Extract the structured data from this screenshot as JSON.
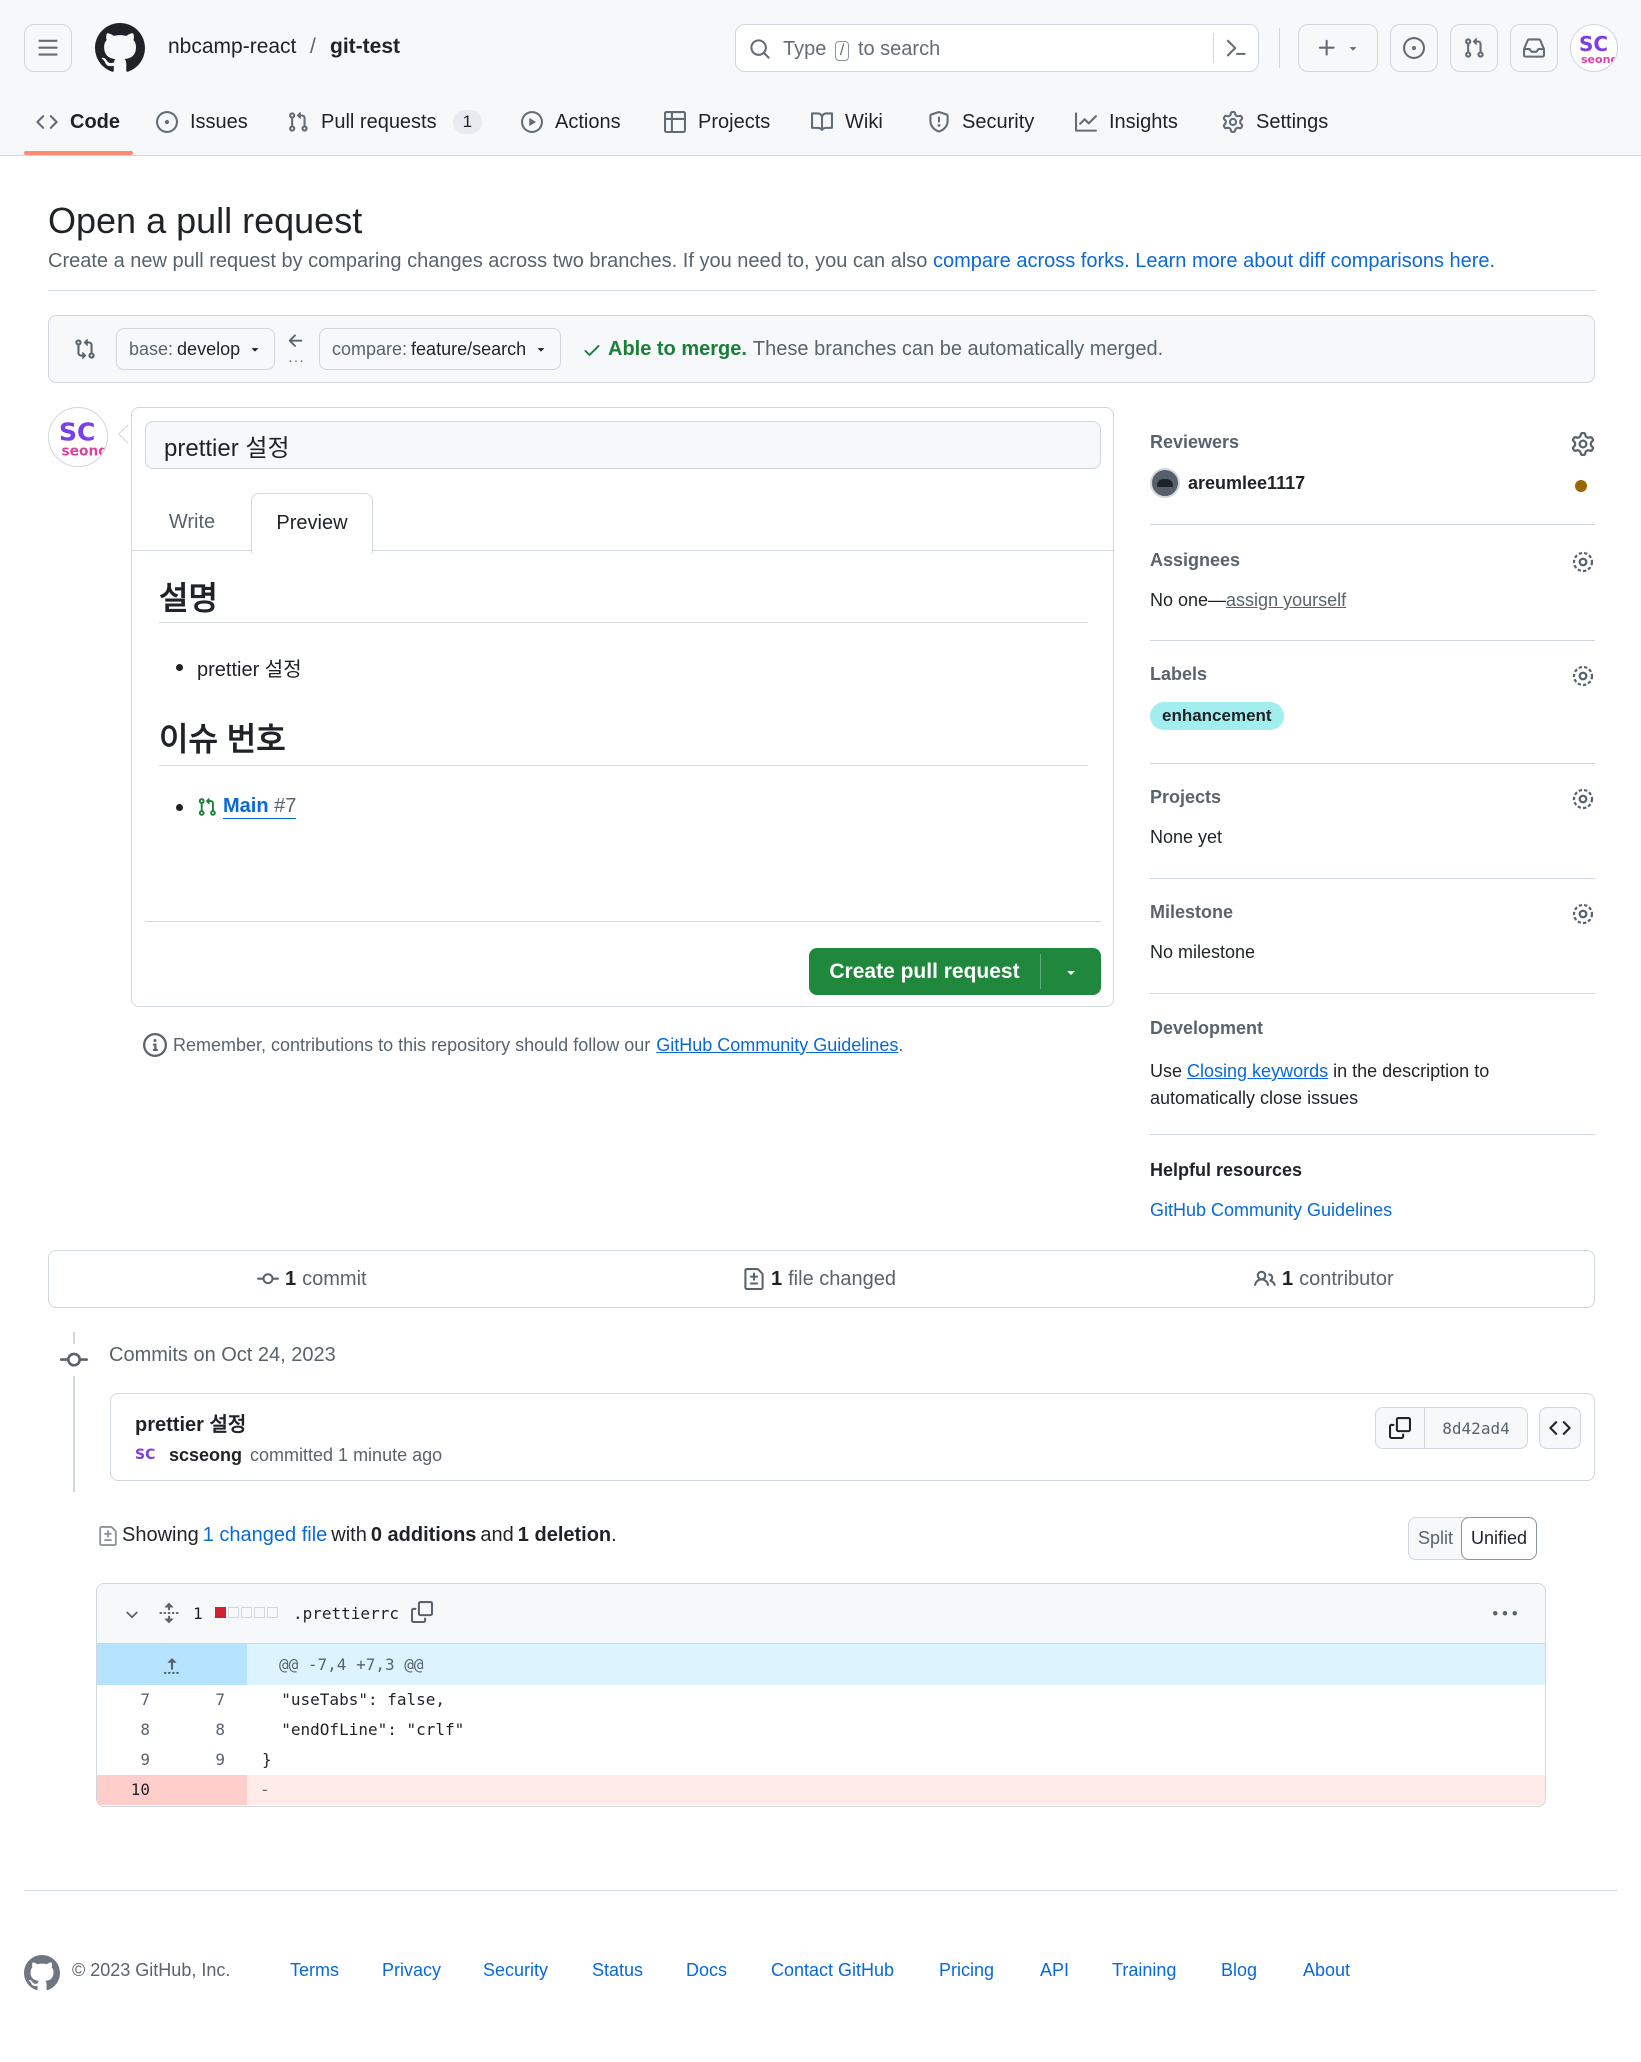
{
  "header": {
    "owner": "nbcamp-react",
    "separator": "/",
    "repo": "git-test",
    "search": {
      "before": "Type",
      "key": "/",
      "after": "to search"
    }
  },
  "repo_tabs": [
    {
      "label": "Code",
      "icon": "code-icon"
    },
    {
      "label": "Issues",
      "icon": "issue-opened-icon"
    },
    {
      "label": "Pull requests",
      "icon": "git-pull-request-icon",
      "count": "1"
    },
    {
      "label": "Actions",
      "icon": "play-icon"
    },
    {
      "label": "Projects",
      "icon": "table-icon"
    },
    {
      "label": "Wiki",
      "icon": "book-icon"
    },
    {
      "label": "Security",
      "icon": "shield-icon"
    },
    {
      "label": "Insights",
      "icon": "graph-icon"
    },
    {
      "label": "Settings",
      "icon": "gear-icon"
    }
  ],
  "page": {
    "title": "Open a pull request",
    "subtitle_text": "Create a new pull request by comparing changes across two branches. If you need to, you can also",
    "subtitle_link1": "compare across forks.",
    "subtitle_link2": "Learn more about diff comparisons here."
  },
  "compare": {
    "base_label": "base:",
    "base_value": "develop",
    "compare_label": "compare:",
    "compare_value": "feature/search",
    "merge_status": "Able to merge.",
    "merge_note": "These branches can be automatically merged."
  },
  "editor": {
    "title_value": "prettier 설정",
    "tab_write": "Write",
    "tab_preview": "Preview",
    "heading1": "설명",
    "item1": "prettier 설정",
    "heading2": "이슈 번호",
    "issue_link": "Main",
    "issue_number": "#7",
    "create_button": "Create pull request"
  },
  "remember": {
    "text": "Remember, contributions to this repository should follow our",
    "link": "GitHub Community Guidelines",
    "end": "."
  },
  "sidebar": {
    "reviewers": {
      "title": "Reviewers",
      "name": "areumlee1117"
    },
    "assignees": {
      "title": "Assignees",
      "none": "No one—",
      "link": "assign yourself"
    },
    "labels": {
      "title": "Labels",
      "label": "enhancement"
    },
    "projects": {
      "title": "Projects",
      "value": "None yet"
    },
    "milestone": {
      "title": "Milestone",
      "value": "No milestone"
    },
    "development": {
      "title": "Development",
      "use": "Use",
      "link": "Closing keywords",
      "rest1": "in the description to",
      "rest2": "automatically close issues"
    },
    "helpful": {
      "title": "Helpful resources",
      "link": "GitHub Community Guidelines"
    }
  },
  "summary": {
    "commits_n": "1",
    "commits_l": "commit",
    "files_n": "1",
    "files_l": "file changed",
    "contrib_n": "1",
    "contrib_l": "contributor"
  },
  "commits": {
    "date_heading": "Commits on Oct 24, 2023",
    "message": "prettier 설정",
    "author": "scseong",
    "meta": "committed 1 minute ago",
    "sha": "8d42ad4"
  },
  "diff": {
    "showing": "Showing",
    "changed_link": "1 changed file",
    "with": "with",
    "additions": "0 additions",
    "and": "and",
    "deletions": "1 deletion",
    "period": ".",
    "split": "Split",
    "unified": "Unified",
    "file_count": "1",
    "filename": ".prettierrc",
    "hunk": "@@ -7,4 +7,3 @@",
    "lines": [
      {
        "old": "7",
        "new": "7",
        "code": "  \"useTabs\": false,"
      },
      {
        "old": "8",
        "new": "8",
        "code": "  \"endOfLine\": \"crlf\""
      },
      {
        "old": "9",
        "new": "9",
        "code": "}"
      },
      {
        "old": "10",
        "new": "",
        "code": "-"
      }
    ]
  },
  "footer": {
    "copyright": "© 2023 GitHub, Inc.",
    "links": [
      "Terms",
      "Privacy",
      "Security",
      "Status",
      "Docs",
      "Contact GitHub",
      "Pricing",
      "API",
      "Training",
      "Blog",
      "About"
    ]
  },
  "colors": {
    "accent_green": "#1f883d",
    "link_blue": "#0969da",
    "label_bg": "#a2eeef",
    "deletion_bg": "#ffebe9",
    "hunk_bg": "#ddf4ff",
    "tab_underline": "#fd8c73",
    "reviewer_pending": "#9a6700"
  }
}
